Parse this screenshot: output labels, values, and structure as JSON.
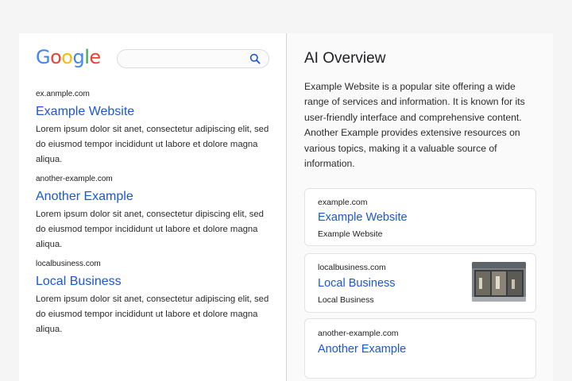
{
  "logo": {
    "letters": [
      "G",
      "o",
      "o",
      "g",
      "l",
      "e"
    ],
    "colors": [
      "#4285F4",
      "#EA4335",
      "#FBBC05",
      "#4285F4",
      "#34A853",
      "#EA4335"
    ]
  },
  "search": {
    "value": "",
    "placeholder": "",
    "icon": "search-icon"
  },
  "results": [
    {
      "url": "ex.anmple.com",
      "title": "Example Website",
      "snippet": "Lorem ipsum dolor sit anet, consectetur adipiscing elit, sed do eiusmod tempor incididunt ut labore et dolore magna aliqua."
    },
    {
      "url": "another-example.com",
      "title": "Another Example",
      "snippet": "Lorem ipsum dolor sit anet, consectetur dipiscing elit, sed do eiusmod tempor incididunt ut labore et dolore magna aliqua."
    },
    {
      "url": "localbusiness.com",
      "title": "Local Business",
      "snippet": "Lorem ipsum dolor sit anet, consectetur adipiscing elit, sed do eiusmod tempor incididunt ut labore et dolore magna aliqua."
    }
  ],
  "ai_overview": {
    "title": "AI Overview",
    "text": "Example Website is a popular site offering a wide range of services and information. It is known for its user-friendly interface and comprehensive content. Another Example provides extensive resources on various topics, making it a valuable source of information.",
    "cards": [
      {
        "domain": "example.com",
        "title": "Example Website",
        "subtitle": "Example Website"
      },
      {
        "domain": "localbusiness.com",
        "title": "Local Business",
        "subtitle": "Local Business",
        "thumbnail": "storefront-image"
      },
      {
        "domain": "another-example.com",
        "title": "Another Example"
      }
    ]
  },
  "colors": {
    "link": "#1a57d6",
    "divider": "#d6d6d6"
  }
}
